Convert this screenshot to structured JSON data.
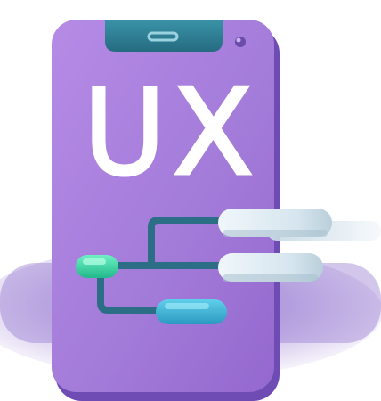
{
  "illustration": {
    "icon": "mobile-ux-flow-icon",
    "screen_text": "UX",
    "colors": {
      "phone_body": "#a27ad8",
      "phone_shadow": "#6f4bb4",
      "notch": "#2f7f95",
      "connector": "#2c6e86",
      "start_node": "#3ed3a5",
      "end_node": "#3aa9cf",
      "panel": "#d9e7ef",
      "letters": "#ffffff",
      "ground_shadow": "#9a7fd0"
    }
  }
}
